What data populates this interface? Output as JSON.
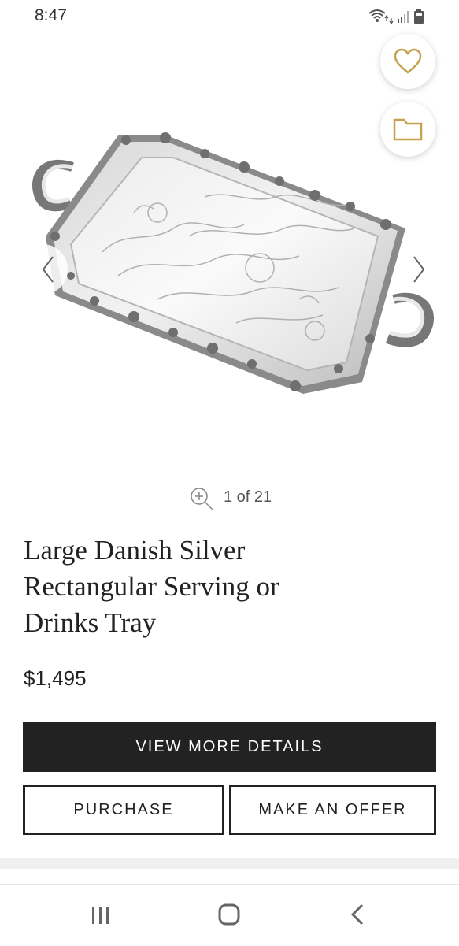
{
  "status_bar": {
    "time": "8:47",
    "icons": [
      "wifi-icon",
      "signal-icon",
      "battery-icon"
    ]
  },
  "actions": {
    "favorite_icon": "heart-icon",
    "folder_icon": "folder-icon",
    "accent_color": "#C4A24D"
  },
  "gallery": {
    "counter_text": "1 of 21",
    "current_index": 1,
    "total_images": 21
  },
  "product": {
    "title_lines": [
      "Large Danish Silver",
      "Rectangular Serving or",
      "Drinks Tray"
    ],
    "price": "$1,495"
  },
  "buttons": {
    "details_label": "VIEW MORE DETAILS",
    "purchase_label": "PURCHASE",
    "offer_label": "MAKE AN OFFER"
  },
  "system_nav": {
    "icons": [
      "recent-apps-icon",
      "home-icon",
      "back-icon"
    ]
  }
}
